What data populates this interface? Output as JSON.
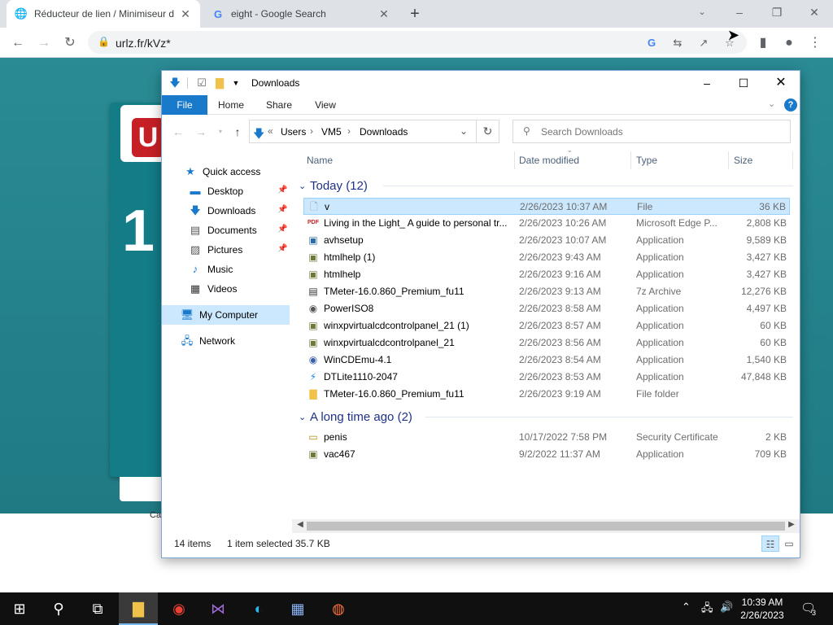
{
  "browser": {
    "tabs": [
      {
        "title": "Réducteur de lien / Minimiseur d",
        "favicon": "globe-icon",
        "active": true
      },
      {
        "title": "eight - Google Search",
        "favicon": "google-icon",
        "active": false
      }
    ],
    "url": "urlz.fr/kVz*"
  },
  "page": {
    "logo_letter": "U",
    "big_number": "1",
    "caption": "Ca"
  },
  "explorer": {
    "title": "Downloads",
    "ribbon_tabs": [
      "File",
      "Home",
      "Share",
      "View"
    ],
    "breadcrumb": [
      "Users",
      "VM5",
      "Downloads"
    ],
    "breadcrumb_prefix": "«",
    "search_placeholder": "Search Downloads",
    "nav": [
      {
        "label": "Quick access",
        "icon": "star-icon",
        "pinned": false
      },
      {
        "label": "Desktop",
        "icon": "desktop-icon",
        "pinned": true
      },
      {
        "label": "Downloads",
        "icon": "download-arrow-icon",
        "pinned": true
      },
      {
        "label": "Documents",
        "icon": "document-icon",
        "pinned": true
      },
      {
        "label": "Pictures",
        "icon": "pictures-icon",
        "pinned": true
      },
      {
        "label": "Music",
        "icon": "music-icon",
        "pinned": false
      },
      {
        "label": "Videos",
        "icon": "videos-icon",
        "pinned": false
      },
      {
        "label": "My Computer",
        "icon": "computer-icon",
        "pinned": false
      },
      {
        "label": "Network",
        "icon": "network-icon",
        "pinned": false
      }
    ],
    "columns": [
      "Name",
      "Date modified",
      "Type",
      "Size"
    ],
    "groups": [
      {
        "label": "Today (12)",
        "rows": [
          {
            "name": "v",
            "date": "2/26/2023 10:37 AM",
            "type": "File",
            "size": "36 KB",
            "icon": "file-icon"
          },
          {
            "name": "Living in the Light_ A guide to personal tr...",
            "date": "2/26/2023 10:26 AM",
            "type": "Microsoft Edge P...",
            "size": "2,808 KB",
            "icon": "pdf-icon"
          },
          {
            "name": "avhsetup",
            "date": "2/26/2023 10:07 AM",
            "type": "Application",
            "size": "9,589 KB",
            "icon": "installer-icon"
          },
          {
            "name": "htmlhelp (1)",
            "date": "2/26/2023 9:43 AM",
            "type": "Application",
            "size": "3,427 KB",
            "icon": "installer-icon"
          },
          {
            "name": "htmlhelp",
            "date": "2/26/2023 9:16 AM",
            "type": "Application",
            "size": "3,427 KB",
            "icon": "installer-icon"
          },
          {
            "name": "TMeter-16.0.860_Premium_fu11",
            "date": "2/26/2023 9:13 AM",
            "type": "7z Archive",
            "size": "12,276 KB",
            "icon": "archive-icon"
          },
          {
            "name": "PowerISO8",
            "date": "2/26/2023 8:58 AM",
            "type": "Application",
            "size": "4,497 KB",
            "icon": "disc-icon"
          },
          {
            "name": "winxpvirtualcdcontrolpanel_21 (1)",
            "date": "2/26/2023 8:57 AM",
            "type": "Application",
            "size": "60 KB",
            "icon": "installer-icon"
          },
          {
            "name": "winxpvirtualcdcontrolpanel_21",
            "date": "2/26/2023 8:56 AM",
            "type": "Application",
            "size": "60 KB",
            "icon": "installer-icon"
          },
          {
            "name": "WinCDEmu-4.1",
            "date": "2/26/2023 8:54 AM",
            "type": "Application",
            "size": "1,540 KB",
            "icon": "disc-icon"
          },
          {
            "name": "DTLite1110-2047",
            "date": "2/26/2023 8:53 AM",
            "type": "Application",
            "size": "47,848 KB",
            "icon": "daemon-icon"
          },
          {
            "name": "TMeter-16.0.860_Premium_fu11",
            "date": "2/26/2023 9:19 AM",
            "type": "File folder",
            "size": "",
            "icon": "folder-icon"
          }
        ]
      },
      {
        "label": "A long time ago (2)",
        "rows": [
          {
            "name": "penis",
            "date": "10/17/2022 7:58 PM",
            "type": "Security Certificate",
            "size": "2 KB",
            "icon": "certificate-icon"
          },
          {
            "name": "vac467",
            "date": "9/2/2022 11:37 AM",
            "type": "Application",
            "size": "709 KB",
            "icon": "installer-icon"
          }
        ]
      }
    ],
    "status": {
      "items": "14 items",
      "selected": "1 item selected",
      "size": "35.7 KB"
    }
  },
  "taskbar": {
    "apps": [
      "start-icon",
      "search-icon",
      "task-view-icon",
      "file-explorer-icon",
      "chrome-icon",
      "visual-studio-icon",
      "edge-icon",
      "calculator-icon",
      "firefox-icon"
    ],
    "time": "10:39 AM",
    "date": "2/26/2023",
    "notification_count": "3"
  }
}
